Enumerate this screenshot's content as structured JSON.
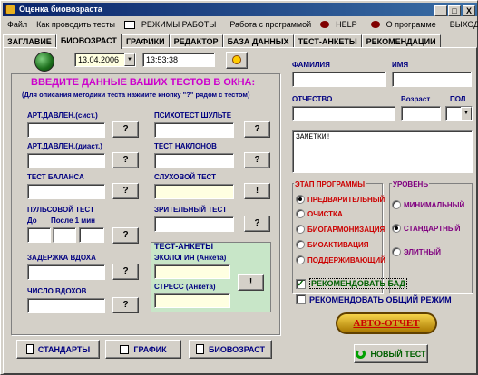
{
  "window": {
    "title": "Оценка биовозраста",
    "min": "_",
    "max": "□",
    "close": "X"
  },
  "menu": [
    "Файл",
    "Как проводить тесты",
    "РЕЖИМЫ РАБОТЫ",
    "Работа с программой",
    "HELP",
    "О программе",
    "ВЫХОД"
  ],
  "tabs": [
    "ЗАГЛАВИЕ",
    "БИОВОЗРАСТ",
    "ГРАФИКИ",
    "РЕДАКТОР",
    "БАЗА ДАННЫХ",
    "ТЕСТ-АНКЕТЫ",
    "РЕКОМЕНДАЦИИ"
  ],
  "date": "13.04.2006",
  "time": "13:53:38",
  "heading": "ВВЕДИТЕ ДАННЫЕ ВАШИХ ТЕСТОВ В ОКНА:",
  "subheading": "(Для описания методики теста нажмите кнопку \"?\" рядом с тестом)",
  "tests_left": {
    "art_sys": "АРТ.ДАВЛЕН.(сист.)",
    "art_dia": "АРТ.ДАВЛЕН.(диаст.)",
    "balance": "ТЕСТ БАЛАНСА",
    "pulse": "ПУЛЬСОВОЙ ТЕСТ",
    "pulse_before": "До",
    "pulse_after": "После 1 мин",
    "breath": "ЗАДЕРЖКА ВДОХА",
    "breaths": "ЧИСЛО ВДОХОВ"
  },
  "tests_right": {
    "schulte": "ПСИХОТЕСТ ШУЛЬТЕ",
    "bends": "ТЕСТ НАКЛОНОВ",
    "hearing": "СЛУХОВОЙ ТЕСТ",
    "vision": "ЗРИТЕЛЬНЫЙ ТЕСТ"
  },
  "questionnaires": {
    "title": "ТЕСТ-АНКЕТЫ",
    "ecology": "ЭКОЛОГИЯ (Анкета)",
    "stress": "СТРЕСС (Анкета)"
  },
  "person": {
    "surname": "ФАМИЛИЯ",
    "name": "ИМЯ",
    "patronymic": "ОТЧЕСТВО",
    "age": "Возраст",
    "sex": "ПОЛ"
  },
  "notes": "ЗАМЕТКИ!",
  "stage": {
    "title": "ЭТАП ПРОГРАММЫ",
    "options": [
      "ПРЕДВАРИТЕЛЬНЫЙ",
      "ОЧИСТКА",
      "БИОГАРМОНИЗАЦИЯ",
      "БИОАКТИВАЦИЯ",
      "ПОДДЕРЖИВАЮЩИЙ"
    ]
  },
  "level": {
    "title": "УРОВЕНЬ",
    "options": [
      "МИНИМАЛЬНЫЙ",
      "СТАНДАРТНЫЙ",
      "ЭЛИТНЫЙ"
    ]
  },
  "checks": {
    "bad": "РЕКОМЕНДОВАТЬ БАД",
    "general": "РЕКОМЕНДОВАТЬ ОБЩИЙ РЕЖИМ"
  },
  "buttons": {
    "standards": "СТАНДАРТЫ",
    "graph": "ГРАФИК",
    "bioage": "БИОВОЗРАСТ",
    "autoreport": "АВТО-ОТЧЕТ",
    "new_test": "НОВЫЙ ТЕСТ",
    "q": "?",
    "excl": "!"
  },
  "colors": {
    "accent": "#000080",
    "heading": "#cc00cc",
    "stage": "#cc0000",
    "level": "#800080"
  }
}
